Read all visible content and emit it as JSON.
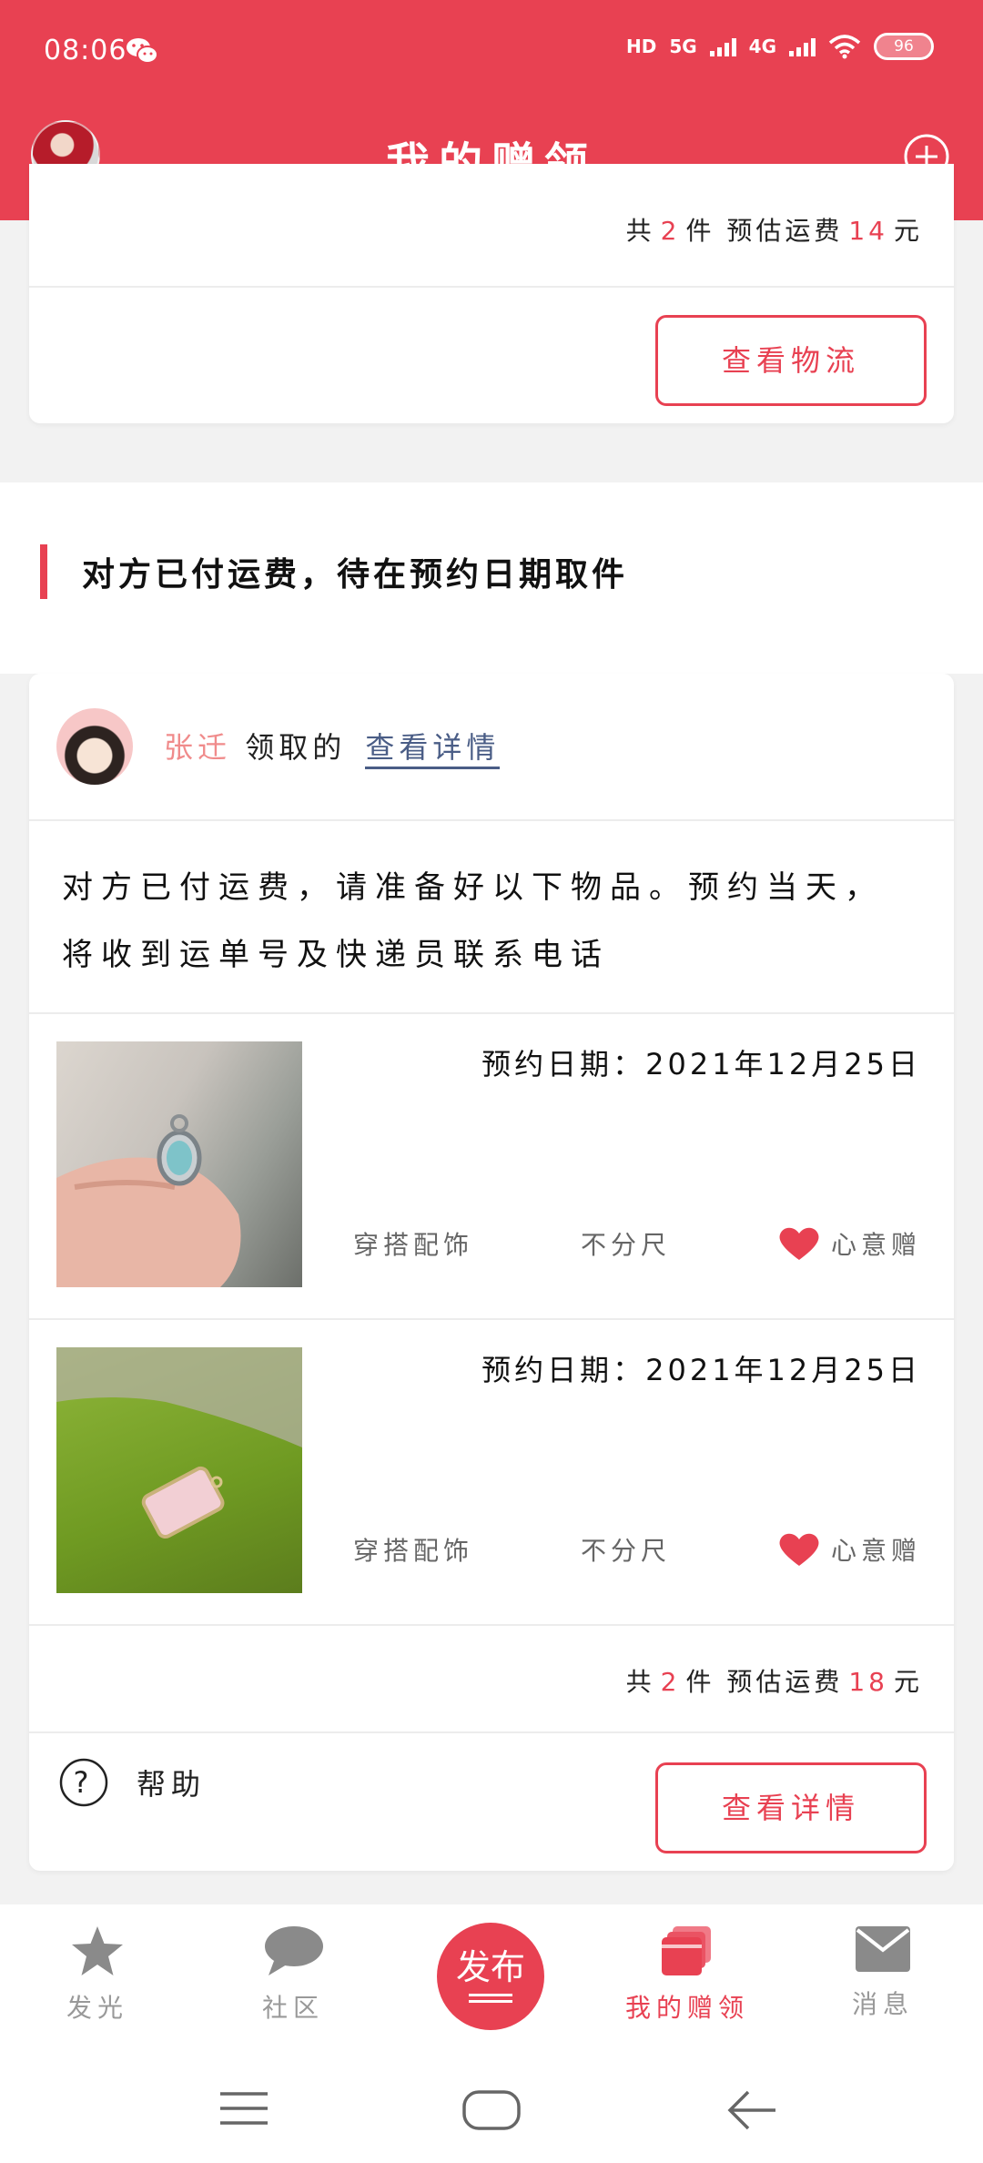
{
  "status_bar": {
    "time": "08:06",
    "network_1": "HD",
    "network_2": "5G",
    "network_3": "4G",
    "battery": "96"
  },
  "header": {
    "title": "我的赠领"
  },
  "top_card": {
    "summary_prefix": "共",
    "summary_count": "2",
    "summary_middle": "件 预估运费",
    "summary_fee": "14",
    "summary_unit": "元",
    "button_label": "查看物流"
  },
  "section": {
    "title": "对方已付运费，待在预约日期取件"
  },
  "main_card": {
    "giver_name": "张迁",
    "giver_action": "领取的",
    "giver_link": "查看详情",
    "notice": "对方已付运费，请准备好以下物品。预约当天，将收到运单号及快递员联系电话",
    "items": [
      {
        "date_label": "预约日期：",
        "date_value": "2021年12月25日",
        "category": "穿搭配饰",
        "size": "不分尺",
        "type": "心意赠"
      },
      {
        "date_label": "预约日期：",
        "date_value": "2021年12月25日",
        "category": "穿搭配饰",
        "size": "不分尺",
        "type": "心意赠"
      }
    ],
    "summary_prefix": "共",
    "summary_count": "2",
    "summary_middle": "件 预估运费",
    "summary_fee": "18",
    "summary_unit": "元",
    "help_label": "帮助",
    "button_label": "查看详情"
  },
  "tabbar": {
    "tabs": [
      {
        "label": "发光",
        "icon": "star-icon"
      },
      {
        "label": "社区",
        "icon": "chat-bubble-icon"
      },
      {
        "label": "发布",
        "icon": "publish-icon"
      },
      {
        "label": "我的赠领",
        "icon": "gift-box-icon"
      },
      {
        "label": "消息",
        "icon": "envelope-icon"
      }
    ]
  },
  "colors": {
    "accent": "#e84152",
    "link": "#4a5d86",
    "giver_name": "#f08b8b"
  }
}
